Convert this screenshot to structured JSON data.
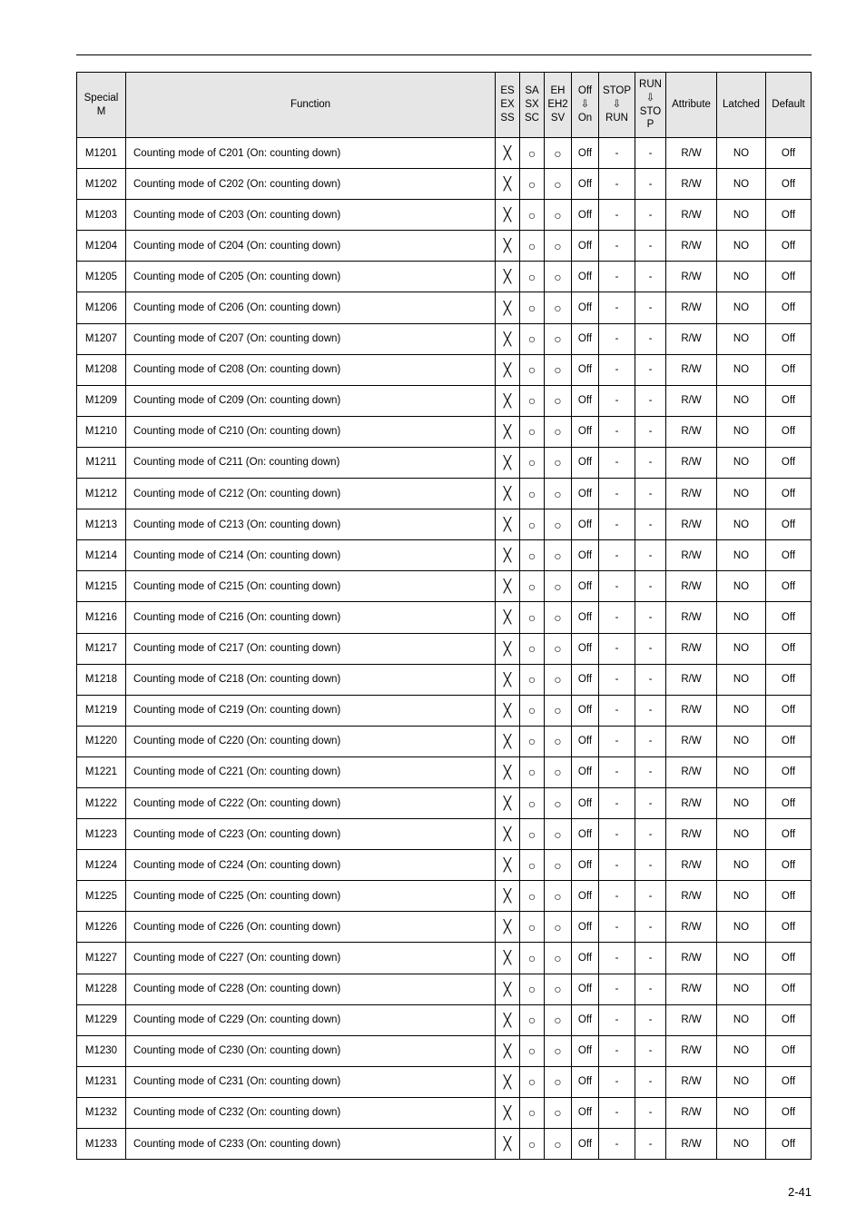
{
  "headers": {
    "special": "Special\nM",
    "function": "Function",
    "es": "ES\nEX\nSS",
    "sa": "SA\nSX\nSC",
    "eh": "EH\nEH2\nSV",
    "off": "Off\n⇩\nOn",
    "stop": "STOP\n⇩\nRUN",
    "run": "RUN\n⇩\nSTO\nP",
    "attribute": "Attribute",
    "latched": "Latched",
    "default": "Default"
  },
  "rows": [
    {
      "id": "M1201",
      "func": "Counting mode of C201 (On: counting down)",
      "es": "╳",
      "sa": "○",
      "eh": "○",
      "off": "Off",
      "stop": "-",
      "run": "-",
      "attr": "R/W",
      "latched": "NO",
      "def": "Off"
    },
    {
      "id": "M1202",
      "func": "Counting mode of C202 (On: counting down)",
      "es": "╳",
      "sa": "○",
      "eh": "○",
      "off": "Off",
      "stop": "-",
      "run": "-",
      "attr": "R/W",
      "latched": "NO",
      "def": "Off"
    },
    {
      "id": "M1203",
      "func": "Counting mode of C203 (On: counting down)",
      "es": "╳",
      "sa": "○",
      "eh": "○",
      "off": "Off",
      "stop": "-",
      "run": "-",
      "attr": "R/W",
      "latched": "NO",
      "def": "Off"
    },
    {
      "id": "M1204",
      "func": "Counting mode of C204 (On: counting down)",
      "es": "╳",
      "sa": "○",
      "eh": "○",
      "off": "Off",
      "stop": "-",
      "run": "-",
      "attr": "R/W",
      "latched": "NO",
      "def": "Off"
    },
    {
      "id": "M1205",
      "func": "Counting mode of C205 (On: counting down)",
      "es": "╳",
      "sa": "○",
      "eh": "○",
      "off": "Off",
      "stop": "-",
      "run": "-",
      "attr": "R/W",
      "latched": "NO",
      "def": "Off"
    },
    {
      "id": "M1206",
      "func": "Counting mode of C206 (On: counting down)",
      "es": "╳",
      "sa": "○",
      "eh": "○",
      "off": "Off",
      "stop": "-",
      "run": "-",
      "attr": "R/W",
      "latched": "NO",
      "def": "Off"
    },
    {
      "id": "M1207",
      "func": "Counting mode of C207 (On: counting down)",
      "es": "╳",
      "sa": "○",
      "eh": "○",
      "off": "Off",
      "stop": "-",
      "run": "-",
      "attr": "R/W",
      "latched": "NO",
      "def": "Off"
    },
    {
      "id": "M1208",
      "func": "Counting mode of C208 (On: counting down)",
      "es": "╳",
      "sa": "○",
      "eh": "○",
      "off": "Off",
      "stop": "-",
      "run": "-",
      "attr": "R/W",
      "latched": "NO",
      "def": "Off"
    },
    {
      "id": "M1209",
      "func": "Counting mode of C209 (On: counting down)",
      "es": "╳",
      "sa": "○",
      "eh": "○",
      "off": "Off",
      "stop": "-",
      "run": "-",
      "attr": "R/W",
      "latched": "NO",
      "def": "Off"
    },
    {
      "id": "M1210",
      "func": "Counting mode of C210 (On: counting down)",
      "es": "╳",
      "sa": "○",
      "eh": "○",
      "off": "Off",
      "stop": "-",
      "run": "-",
      "attr": "R/W",
      "latched": "NO",
      "def": "Off"
    },
    {
      "id": "M1211",
      "func": "Counting mode of C211 (On: counting down)",
      "es": "╳",
      "sa": "○",
      "eh": "○",
      "off": "Off",
      "stop": "-",
      "run": "-",
      "attr": "R/W",
      "latched": "NO",
      "def": "Off"
    },
    {
      "id": "M1212",
      "func": "Counting mode of C212 (On: counting down)",
      "es": "╳",
      "sa": "○",
      "eh": "○",
      "off": "Off",
      "stop": "-",
      "run": "-",
      "attr": "R/W",
      "latched": "NO",
      "def": "Off"
    },
    {
      "id": "M1213",
      "func": "Counting mode of C213 (On: counting down)",
      "es": "╳",
      "sa": "○",
      "eh": "○",
      "off": "Off",
      "stop": "-",
      "run": "-",
      "attr": "R/W",
      "latched": "NO",
      "def": "Off"
    },
    {
      "id": "M1214",
      "func": "Counting mode of C214 (On: counting down)",
      "es": "╳",
      "sa": "○",
      "eh": "○",
      "off": "Off",
      "stop": "-",
      "run": "-",
      "attr": "R/W",
      "latched": "NO",
      "def": "Off"
    },
    {
      "id": "M1215",
      "func": "Counting mode of C215 (On: counting down)",
      "es": "╳",
      "sa": "○",
      "eh": "○",
      "off": "Off",
      "stop": "-",
      "run": "-",
      "attr": "R/W",
      "latched": "NO",
      "def": "Off"
    },
    {
      "id": "M1216",
      "func": "Counting mode of C216 (On: counting down)",
      "es": "╳",
      "sa": "○",
      "eh": "○",
      "off": "Off",
      "stop": "-",
      "run": "-",
      "attr": "R/W",
      "latched": "NO",
      "def": "Off"
    },
    {
      "id": "M1217",
      "func": "Counting mode of C217 (On: counting down)",
      "es": "╳",
      "sa": "○",
      "eh": "○",
      "off": "Off",
      "stop": "-",
      "run": "-",
      "attr": "R/W",
      "latched": "NO",
      "def": "Off"
    },
    {
      "id": "M1218",
      "func": "Counting mode of C218 (On: counting down)",
      "es": "╳",
      "sa": "○",
      "eh": "○",
      "off": "Off",
      "stop": "-",
      "run": "-",
      "attr": "R/W",
      "latched": "NO",
      "def": "Off"
    },
    {
      "id": "M1219",
      "func": "Counting mode of C219 (On: counting down)",
      "es": "╳",
      "sa": "○",
      "eh": "○",
      "off": "Off",
      "stop": "-",
      "run": "-",
      "attr": "R/W",
      "latched": "NO",
      "def": "Off"
    },
    {
      "id": "M1220",
      "func": "Counting mode of C220 (On: counting down)",
      "es": "╳",
      "sa": "○",
      "eh": "○",
      "off": "Off",
      "stop": "-",
      "run": "-",
      "attr": "R/W",
      "latched": "NO",
      "def": "Off"
    },
    {
      "id": "M1221",
      "func": "Counting mode of C221 (On: counting down)",
      "es": "╳",
      "sa": "○",
      "eh": "○",
      "off": "Off",
      "stop": "-",
      "run": "-",
      "attr": "R/W",
      "latched": "NO",
      "def": "Off"
    },
    {
      "id": "M1222",
      "func": "Counting mode of C222 (On: counting down)",
      "es": "╳",
      "sa": "○",
      "eh": "○",
      "off": "Off",
      "stop": "-",
      "run": "-",
      "attr": "R/W",
      "latched": "NO",
      "def": "Off"
    },
    {
      "id": "M1223",
      "func": "Counting mode of C223 (On: counting down)",
      "es": "╳",
      "sa": "○",
      "eh": "○",
      "off": "Off",
      "stop": "-",
      "run": "-",
      "attr": "R/W",
      "latched": "NO",
      "def": "Off"
    },
    {
      "id": "M1224",
      "func": "Counting mode of C224 (On: counting down)",
      "es": "╳",
      "sa": "○",
      "eh": "○",
      "off": "Off",
      "stop": "-",
      "run": "-",
      "attr": "R/W",
      "latched": "NO",
      "def": "Off"
    },
    {
      "id": "M1225",
      "func": "Counting mode of C225 (On: counting down)",
      "es": "╳",
      "sa": "○",
      "eh": "○",
      "off": "Off",
      "stop": "-",
      "run": "-",
      "attr": "R/W",
      "latched": "NO",
      "def": "Off"
    },
    {
      "id": "M1226",
      "func": "Counting mode of C226 (On: counting down)",
      "es": "╳",
      "sa": "○",
      "eh": "○",
      "off": "Off",
      "stop": "-",
      "run": "-",
      "attr": "R/W",
      "latched": "NO",
      "def": "Off"
    },
    {
      "id": "M1227",
      "func": "Counting mode of C227 (On: counting down)",
      "es": "╳",
      "sa": "○",
      "eh": "○",
      "off": "Off",
      "stop": "-",
      "run": "-",
      "attr": "R/W",
      "latched": "NO",
      "def": "Off"
    },
    {
      "id": "M1228",
      "func": "Counting mode of C228 (On: counting down)",
      "es": "╳",
      "sa": "○",
      "eh": "○",
      "off": "Off",
      "stop": "-",
      "run": "-",
      "attr": "R/W",
      "latched": "NO",
      "def": "Off"
    },
    {
      "id": "M1229",
      "func": "Counting mode of C229 (On: counting down)",
      "es": "╳",
      "sa": "○",
      "eh": "○",
      "off": "Off",
      "stop": "-",
      "run": "-",
      "attr": "R/W",
      "latched": "NO",
      "def": "Off"
    },
    {
      "id": "M1230",
      "func": "Counting mode of C230 (On: counting down)",
      "es": "╳",
      "sa": "○",
      "eh": "○",
      "off": "Off",
      "stop": "-",
      "run": "-",
      "attr": "R/W",
      "latched": "NO",
      "def": "Off"
    },
    {
      "id": "M1231",
      "func": "Counting mode of C231 (On: counting down)",
      "es": "╳",
      "sa": "○",
      "eh": "○",
      "off": "Off",
      "stop": "-",
      "run": "-",
      "attr": "R/W",
      "latched": "NO",
      "def": "Off"
    },
    {
      "id": "M1232",
      "func": "Counting mode of C232 (On: counting down)",
      "es": "╳",
      "sa": "○",
      "eh": "○",
      "off": "Off",
      "stop": "-",
      "run": "-",
      "attr": "R/W",
      "latched": "NO",
      "def": "Off"
    },
    {
      "id": "M1233",
      "func": "Counting mode of C233 (On: counting down)",
      "es": "╳",
      "sa": "○",
      "eh": "○",
      "off": "Off",
      "stop": "-",
      "run": "-",
      "attr": "R/W",
      "latched": "NO",
      "def": "Off"
    }
  ],
  "pagenum": "2-41"
}
